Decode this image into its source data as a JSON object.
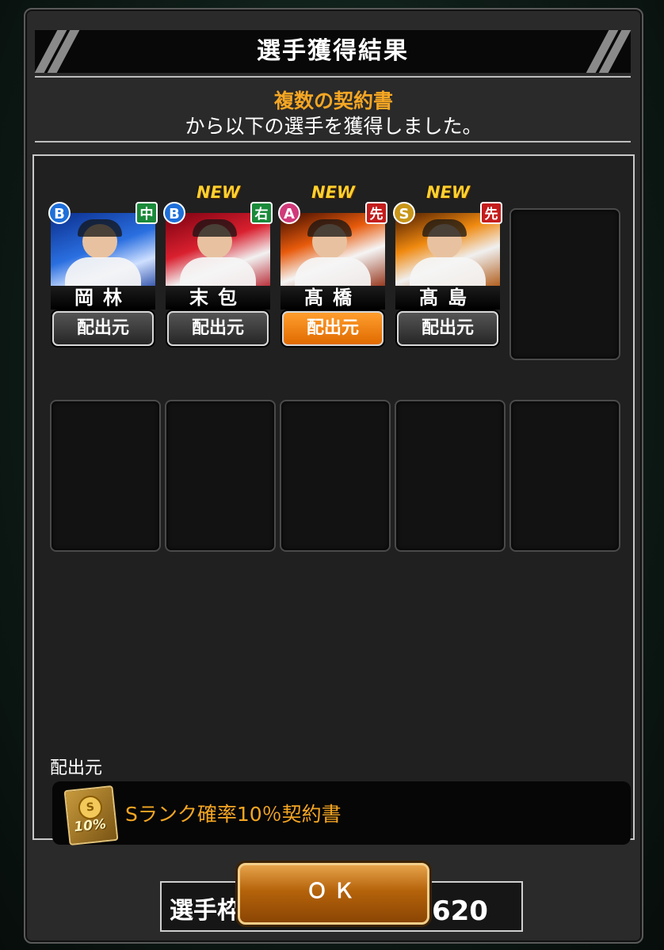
{
  "dialog": {
    "title": "選手獲得結果",
    "subtitle_highlight": "複数の契約書",
    "subtitle_text": "から以下の選手を獲得しました。"
  },
  "cards": [
    {
      "name": "岡林",
      "rank": "B",
      "position": "中",
      "is_new": false,
      "source_button": "配出元",
      "selected": false,
      "rank_color": "#1e6fd9",
      "position_color": "#1a8a3a",
      "photo_theme": "blue"
    },
    {
      "name": "末包",
      "rank": "B",
      "position": "右",
      "is_new": true,
      "source_button": "配出元",
      "selected": false,
      "rank_color": "#1e6fd9",
      "position_color": "#1a8a3a",
      "photo_theme": "red"
    },
    {
      "name": "髙橋",
      "rank": "A",
      "position": "先",
      "is_new": true,
      "source_button": "配出元",
      "selected": true,
      "rank_color": "#d03a7a",
      "position_color": "#c41d1d",
      "photo_theme": "fire"
    },
    {
      "name": "髙島",
      "rank": "S",
      "position": "先",
      "is_new": true,
      "source_button": "配出元",
      "selected": false,
      "rank_color": "#c8961a",
      "position_color": "#c41d1d",
      "photo_theme": "gold"
    }
  ],
  "new_badge": "NEW",
  "source_section": {
    "label": "配出元",
    "item": "Sランク確率10％契約書",
    "ticket_coin": "S",
    "ticket_percent": "10%"
  },
  "capacity": {
    "label": "選手枠：",
    "value": "568／620"
  },
  "ok_button": "ＯＫ"
}
